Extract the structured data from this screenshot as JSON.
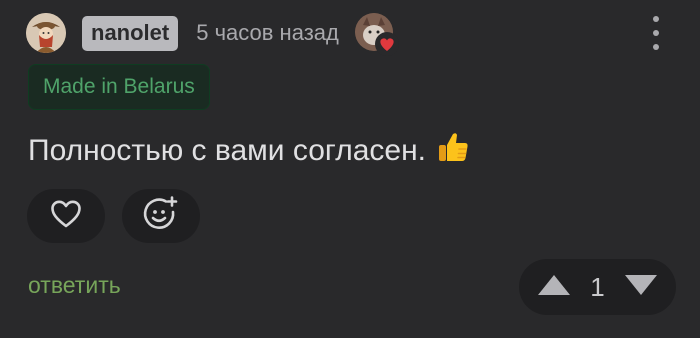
{
  "header": {
    "username": "nanolet",
    "time": "5 часов назад",
    "avatar_icon": "cowboy-avatar",
    "award_icon": "heart-award-icon",
    "more_icon": "more-vertical-icon"
  },
  "badge": {
    "label": "Made in Belarus"
  },
  "comment": {
    "text": "Полностью с вами согласен.",
    "emoji": "👍"
  },
  "reactions": [
    {
      "icon": "heart-outline-icon"
    },
    {
      "icon": "add-emoji-icon"
    }
  ],
  "actions": {
    "reply_label": "ответить"
  },
  "vote": {
    "count": "1",
    "up_icon": "arrow-up-icon",
    "down_icon": "arrow-down-icon"
  },
  "colors": {
    "background": "#29292b",
    "reply_green": "#77a55a",
    "badge_green": "#4fa36a",
    "heart_red": "#e0393e"
  }
}
